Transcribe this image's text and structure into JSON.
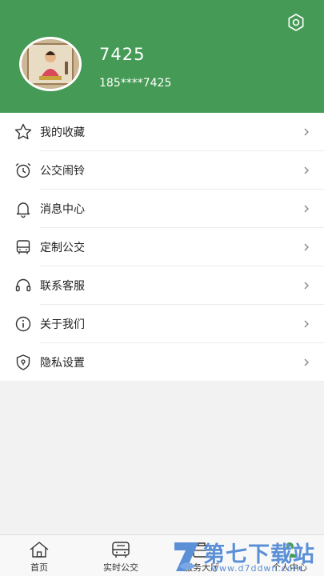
{
  "profile": {
    "username": "7425",
    "phone": "185****7425"
  },
  "menu": {
    "items": [
      {
        "label": "我的收藏",
        "icon": "star-icon"
      },
      {
        "label": "公交闹铃",
        "icon": "alarm-clock-icon"
      },
      {
        "label": "消息中心",
        "icon": "bell-icon"
      },
      {
        "label": "定制公交",
        "icon": "bus-icon"
      },
      {
        "label": "联系客服",
        "icon": "headset-icon"
      },
      {
        "label": "关于我们",
        "icon": "info-icon"
      },
      {
        "label": "隐私设置",
        "icon": "shield-icon"
      }
    ]
  },
  "tabbar": {
    "tabs": [
      {
        "label": "首页",
        "icon": "home-icon"
      },
      {
        "label": "实时公交",
        "icon": "bus-icon"
      },
      {
        "label": "服务大厅",
        "icon": "service-icon"
      },
      {
        "label": "个人中心",
        "icon": "person-icon"
      }
    ]
  },
  "watermark": {
    "title": "第七下载站",
    "url": "www.d7ddwn.com"
  },
  "colors": {
    "header": "#459a55",
    "watermark": "#5b8fd6"
  }
}
